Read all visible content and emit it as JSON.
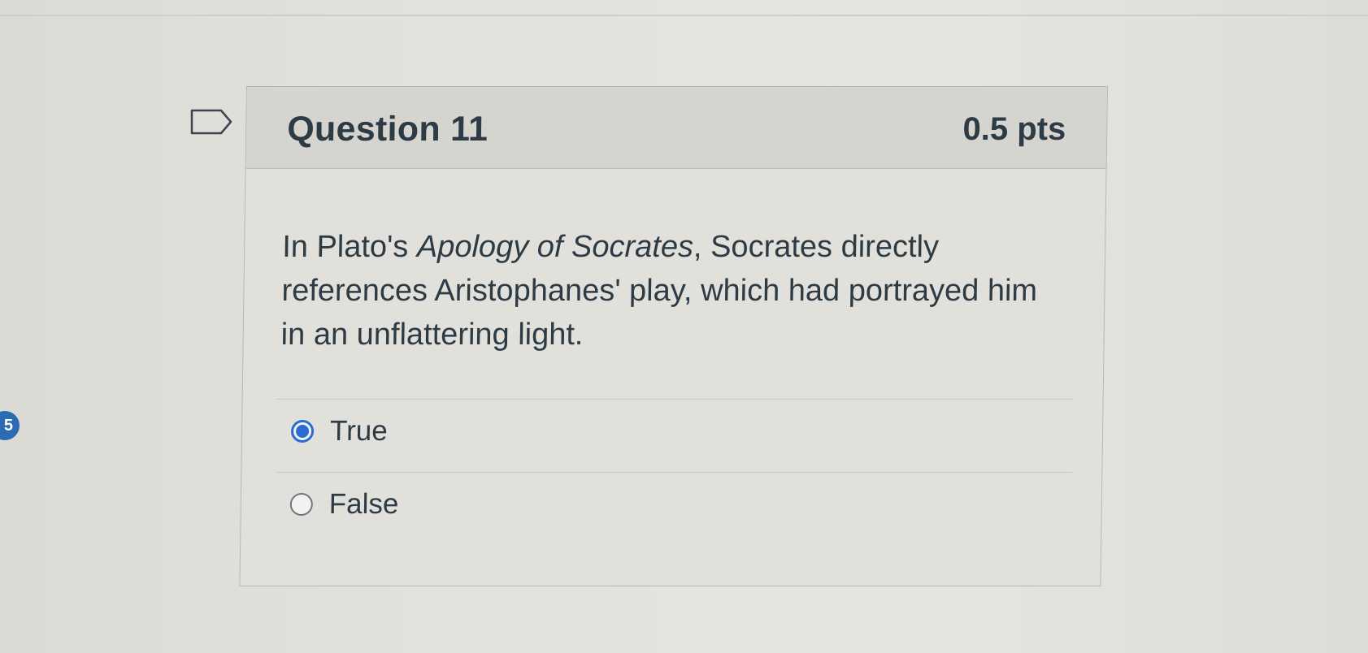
{
  "question": {
    "title": "Question 11",
    "points": "0.5 pts",
    "text_before": "In Plato's ",
    "text_italic": "Apology of Socrates",
    "text_after": ", Socrates directly references Aristophanes' play, which had portrayed him in an unflattering light."
  },
  "answers": [
    {
      "label": "True",
      "selected": true
    },
    {
      "label": "False",
      "selected": false
    }
  ],
  "side_badge": "5",
  "colors": {
    "accent": "#2b6bd6",
    "badge": "#2b6bb3",
    "text": "#2d3b45"
  },
  "icons": {
    "flag": "flag-question-icon"
  }
}
